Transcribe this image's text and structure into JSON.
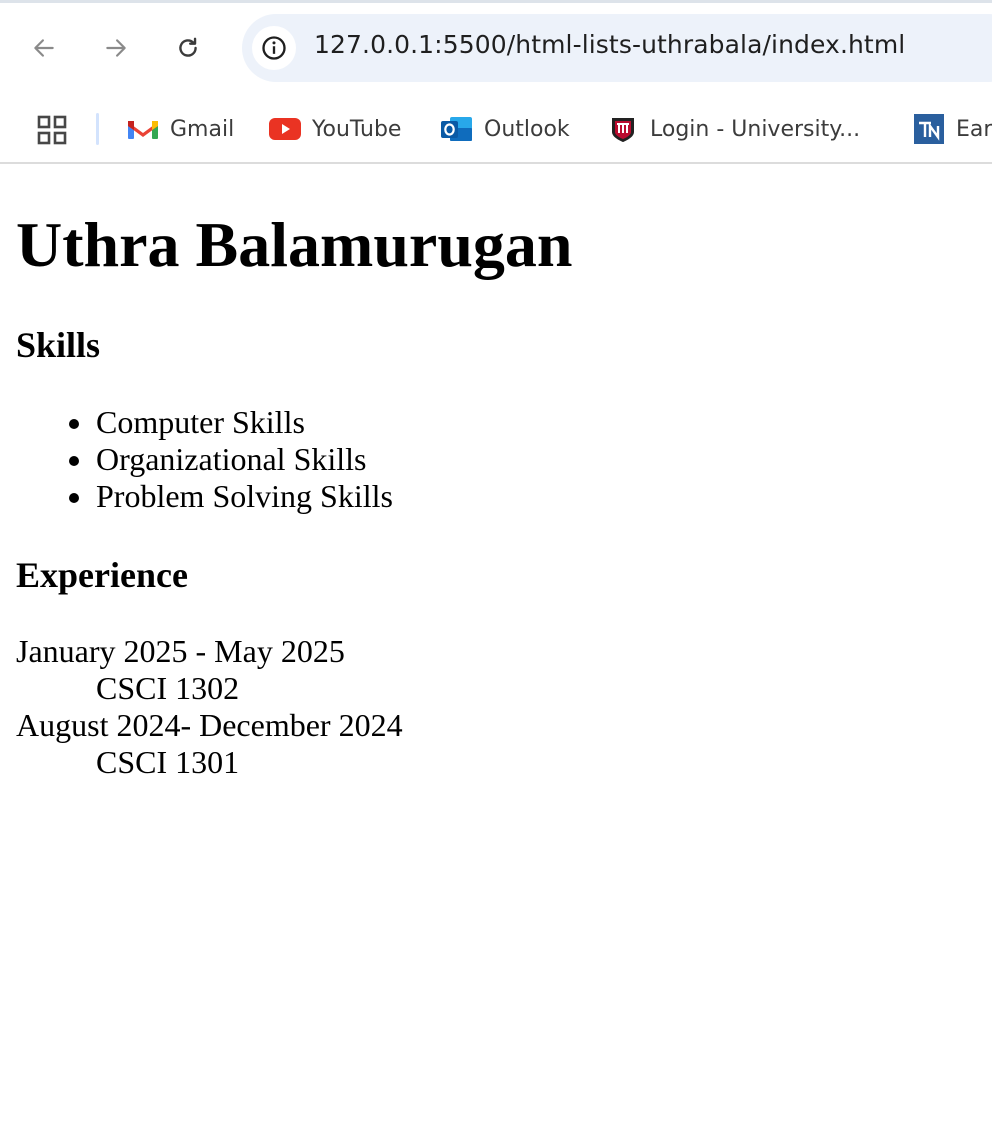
{
  "browser": {
    "url": "127.0.0.1:5500/html-lists-uthrabala/index.html",
    "bookmarks": [
      {
        "label": "Gmail",
        "icon": "gmail-icon"
      },
      {
        "label": "YouTube",
        "icon": "youtube-icon"
      },
      {
        "label": "Outlook",
        "icon": "outlook-icon"
      },
      {
        "label": "Login - University...",
        "icon": "university-icon"
      },
      {
        "label": "Ear",
        "icon": "bookmark-icon"
      }
    ]
  },
  "page": {
    "name": "Uthra Balamurugan",
    "skills_heading": "Skills",
    "skills": [
      "Computer Skills",
      "Organizational Skills",
      "Problem Solving Skills"
    ],
    "experience_heading": "Experience",
    "experience": [
      {
        "term": "January 2025 - May 2025",
        "desc": "CSCI 1302"
      },
      {
        "term": "August 2024- December 2024",
        "desc": "CSCI 1301"
      }
    ]
  },
  "colors": {
    "omnibox": "#edf2fa",
    "youtube_red": "#ea3323",
    "outlook_blue": "#0f6cbd",
    "university_red": "#ba0c2f"
  }
}
